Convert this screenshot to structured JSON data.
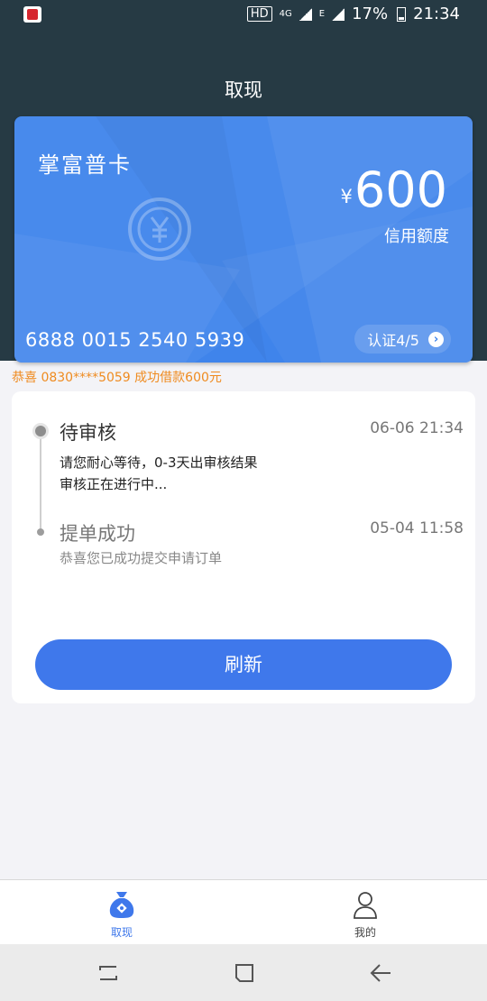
{
  "status_bar": {
    "hd": "HD",
    "net_4g": "4G",
    "net_e": "E",
    "battery": "17%",
    "time": "21:34",
    "app_icon": "app-notification-icon"
  },
  "header": {
    "title": "取现"
  },
  "card": {
    "name": "掌富普卡",
    "currency": "¥",
    "amount": "600",
    "credit_label": "信用额度",
    "number": "6888 0015 2540 5939",
    "verify_label": "认证4/5",
    "verify_icon": "chevron-right-icon",
    "color": "#3f84eb"
  },
  "notice": "恭喜 0830****5059 成功借款600元",
  "timeline": {
    "steps": [
      {
        "title": "待审核",
        "time": "06-06  21:34",
        "desc": [
          "请您耐心等待，0-3天出审核结果",
          "审核正在进行中..."
        ]
      },
      {
        "title": "提单成功",
        "time": "05-04 11:58",
        "desc": [
          "恭喜您已成功提交申请订单"
        ]
      }
    ]
  },
  "refresh_label": "刷新",
  "tabs": [
    {
      "label": "取现",
      "icon": "money-bag-icon",
      "active": true
    },
    {
      "label": "我的",
      "icon": "user-icon",
      "active": false
    }
  ],
  "colors": {
    "primary": "#3f78eb",
    "header_bg": "#263a44",
    "notice": "#ef8b20"
  }
}
